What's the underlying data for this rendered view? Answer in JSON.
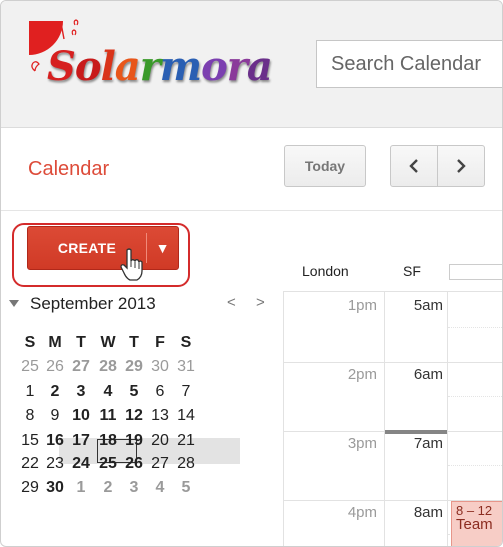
{
  "header": {
    "logo_text": "Solarmora",
    "search_placeholder": "Search Calendar"
  },
  "toolbar": {
    "title": "Calendar",
    "today_label": "Today",
    "prev_label": "‹",
    "next_label": "›"
  },
  "create": {
    "label": "CREATE",
    "dropdown_label": "▼"
  },
  "mini_calendar": {
    "month": "September 2013",
    "prev": "<",
    "next": ">",
    "weekdays": [
      "S",
      "M",
      "T",
      "W",
      "T",
      "F",
      "S"
    ],
    "weeks": [
      [
        "25",
        "26",
        "27",
        "28",
        "29",
        "30",
        "31"
      ],
      [
        "1",
        "2",
        "3",
        "4",
        "5",
        "6",
        "7"
      ],
      [
        "8",
        "9",
        "10",
        "11",
        "12",
        "13",
        "14"
      ],
      [
        "15",
        "16",
        "17",
        "18",
        "19",
        "20",
        "21"
      ],
      [
        "22",
        "23",
        "24",
        "25",
        "26",
        "27",
        "28"
      ],
      [
        "29",
        "30",
        "1",
        "2",
        "3",
        "4",
        "5"
      ]
    ],
    "today": "17"
  },
  "timezones": {
    "primary": "London",
    "secondary": "SF"
  },
  "hours": [
    {
      "london": "1pm",
      "sf": "5am"
    },
    {
      "london": "2pm",
      "sf": "6am"
    },
    {
      "london": "3pm",
      "sf": "7am"
    },
    {
      "london": "4pm",
      "sf": "8am"
    }
  ],
  "event": {
    "time": "8 – 12",
    "title": "Team"
  },
  "colors": {
    "accent": "#dd4b39",
    "create_button": "#d14836"
  }
}
